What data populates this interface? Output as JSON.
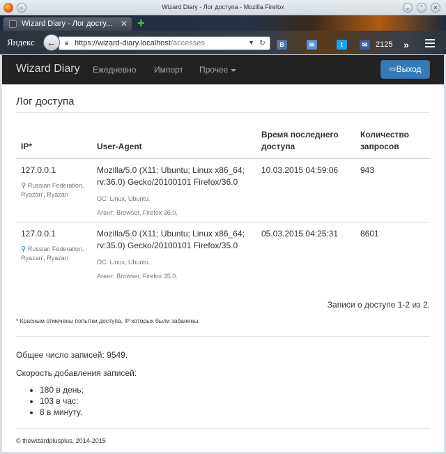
{
  "window": {
    "title": "Wizard Diary - Лог доступа - Mozilla Firefox"
  },
  "browser": {
    "tab_title": "Wizard Diary - Лог досту...",
    "yandex": "Яндекс",
    "url_host": "https://wizard-diary.localhost",
    "url_path": "/accesses",
    "counter": "2125"
  },
  "navbar": {
    "brand": "Wizard Diary",
    "links": [
      "Ежедневно",
      "Импорт",
      "Прочее"
    ],
    "logout": "Выход"
  },
  "page": {
    "title": "Лог доступа",
    "table": {
      "headers": [
        "IP*",
        "User-Agent",
        "Время последнего доступа",
        "Количество запросов"
      ],
      "rows": [
        {
          "ip": "127.0.0.1",
          "location": "Russian Federation, Ryazan', Ryazan",
          "user_agent": "Mozilla/5.0 (X11; Ubuntu; Linux x86_64; rv:36.0) Gecko/20100101 Firefox/36.0",
          "os": "ОС: Linux, Ubuntu.",
          "agent": "Агент: Browser, Firefox 36.0.",
          "time": "10.03.2015 04:59:06",
          "count": "943"
        },
        {
          "ip": "127.0.0.1",
          "location": "Russian Federation, Ryazan', Ryazan",
          "user_agent": "Mozilla/5.0 (X11; Ubuntu; Linux x86_64; rv:35.0) Gecko/20100101 Firefox/35.0",
          "os": "ОС: Linux, Ubuntu.",
          "agent": "Агент: Browser, Firefox 35.0.",
          "time": "05.03.2015 04:25:31",
          "count": "8601"
        }
      ]
    },
    "pager_info": "Записи о доступе 1-2 из 2.",
    "note": "* Красным отмечены попытки доступа, IP которых были забанены.",
    "total": "Общее число записей: 9549.",
    "speed_label": "Скорость добавления записей:",
    "speed": [
      "180 в день;",
      "103 в час;",
      "8 в минуту."
    ],
    "footer": "© thewizardplusplus, 2014-2015"
  },
  "icons": {
    "back": "back-arrow-icon",
    "lock": "lock-icon",
    "vk": "vk-icon",
    "mail": "mail-icon",
    "twitter": "twitter-icon",
    "inbox": "inbox-icon",
    "pin": "map-pin-icon",
    "logout": "logout-icon"
  },
  "colors": {
    "navbar": "#222222",
    "primary": "#337ab7"
  }
}
